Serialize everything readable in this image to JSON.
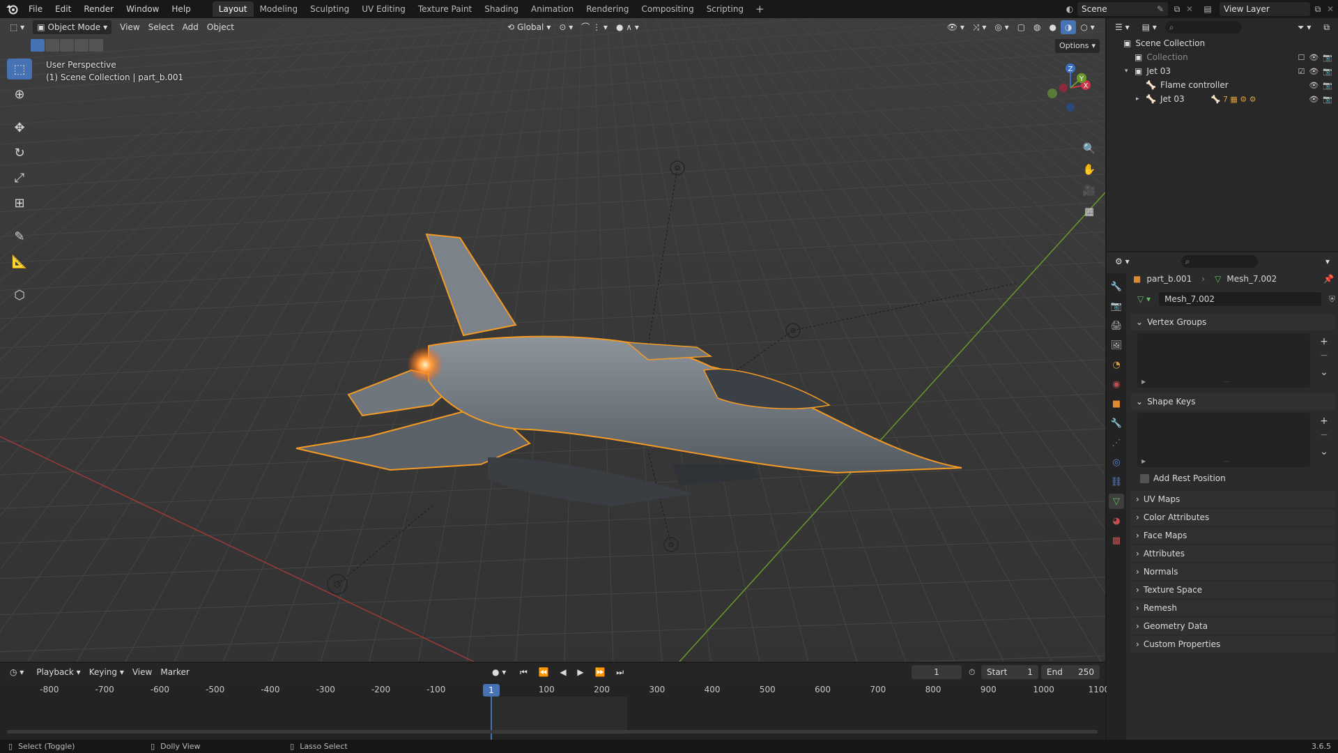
{
  "topbar": {
    "menu": [
      "File",
      "Edit",
      "Render",
      "Window",
      "Help"
    ],
    "workspaces": [
      "Layout",
      "Modeling",
      "Sculpting",
      "UV Editing",
      "Texture Paint",
      "Shading",
      "Animation",
      "Rendering",
      "Compositing",
      "Scripting"
    ],
    "active_workspace": "Layout",
    "add_workspace": "+",
    "scene": "Scene",
    "view_layer": "View Layer"
  },
  "viewport": {
    "mode": "Object Mode",
    "menus": [
      "View",
      "Select",
      "Add",
      "Object"
    ],
    "transform_orientation": "Global",
    "options": "Options",
    "perspective_label": "User Perspective",
    "collection_label": "(1) Scene Collection | part_b.001",
    "gizmo_axes": {
      "z": "Z",
      "y": "Y",
      "x": "X"
    },
    "colors": {
      "selection_outline": "#f59a23",
      "x_axis": "#9e3a3a",
      "y_axis": "#6a9a2a",
      "grid": "#404040",
      "background": "#393939",
      "accent": "#4772b3"
    }
  },
  "timeline": {
    "menus": [
      "Playback",
      "Keying",
      "View",
      "Marker"
    ],
    "ruler_ticks": [
      -800,
      -700,
      -600,
      -500,
      -400,
      -300,
      -200,
      -100,
      100,
      200,
      300,
      400,
      500,
      600,
      700,
      800,
      900,
      1000,
      1100
    ],
    "current_frame": "1",
    "start_label": "Start",
    "start_value": "1",
    "end_label": "End",
    "end_value": "250"
  },
  "statusbar": {
    "items": [
      "Select (Toggle)",
      "Dolly View",
      "Lasso Select"
    ],
    "version": "3.6.5"
  },
  "outliner": {
    "rows": [
      {
        "label": "Scene Collection",
        "level": 0,
        "icon": "collection-icon",
        "dim": false
      },
      {
        "label": "Collection",
        "level": 1,
        "icon": "collection-icon",
        "dim": true
      },
      {
        "label": "Jet 03",
        "level": 1,
        "icon": "collection-icon",
        "dim": false
      },
      {
        "label": "Flame controller",
        "level": 2,
        "icon": "armature-icon",
        "dim": false
      },
      {
        "label": "Jet 03",
        "level": 2,
        "icon": "armature-icon",
        "dim": false
      }
    ],
    "extra_count": "7"
  },
  "properties": {
    "object": "part_b.001",
    "mesh": "Mesh_7.002",
    "datablock": "Mesh_7.002",
    "panels_open": [
      "Vertex Groups",
      "Shape Keys"
    ],
    "add_rest_position": "Add Rest Position",
    "panels_closed": [
      "UV Maps",
      "Color Attributes",
      "Face Maps",
      "Attributes",
      "Normals",
      "Texture Space",
      "Remesh",
      "Geometry Data",
      "Custom Properties"
    ]
  }
}
